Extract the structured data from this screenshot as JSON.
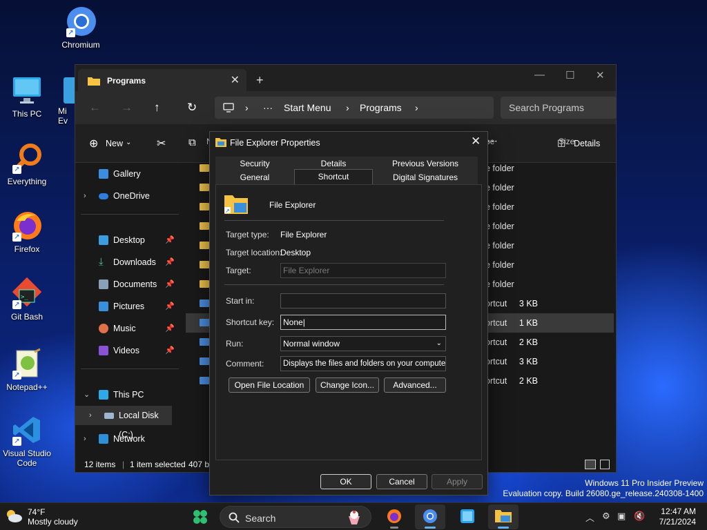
{
  "desktop": {
    "icons": [
      {
        "label": "Chromium"
      },
      {
        "label": "This PC"
      },
      {
        "label": "Everything"
      },
      {
        "label": "Firefox"
      },
      {
        "label": "Git Bash"
      },
      {
        "label": "Notepad++"
      },
      {
        "label": "Visual Studio Code"
      },
      {
        "label": "Mi Ev"
      }
    ]
  },
  "explorer": {
    "tab_title": "Programs",
    "breadcrumb": [
      "Start Menu",
      "Programs"
    ],
    "search_placeholder": "Search Programs",
    "cmd": {
      "new_label": "New",
      "details_label": "Details"
    },
    "sidebar": {
      "gallery": "Gallery",
      "onedrive": "OneDrive",
      "quick": [
        {
          "label": "Desktop"
        },
        {
          "label": "Downloads"
        },
        {
          "label": "Documents"
        },
        {
          "label": "Pictures"
        },
        {
          "label": "Music"
        },
        {
          "label": "Videos"
        }
      ],
      "this_pc": "This PC",
      "local_disk": "Local Disk (C:)",
      "network": "Network"
    },
    "columns": {
      "name_partial": "N",
      "type_partial": "pe",
      "size": "Size"
    },
    "rows": [
      {
        "type": "e folder",
        "size": ""
      },
      {
        "type": "e folder",
        "size": ""
      },
      {
        "type": "e folder",
        "size": ""
      },
      {
        "type": "e folder",
        "size": ""
      },
      {
        "type": "e folder",
        "size": ""
      },
      {
        "type": "e folder",
        "size": ""
      },
      {
        "type": "e folder",
        "size": ""
      },
      {
        "type": "ortcut",
        "size": "3 KB"
      },
      {
        "type": "ortcut",
        "size": "1 KB"
      },
      {
        "type": "ortcut",
        "size": "2 KB"
      },
      {
        "type": "ortcut",
        "size": "3 KB"
      },
      {
        "type": "ortcut",
        "size": "2 KB"
      }
    ],
    "status": {
      "items": "12 items",
      "selected": "1 item selected",
      "size": "407 by"
    }
  },
  "dialog": {
    "title": "File Explorer Properties",
    "tabs_row1": [
      "Security",
      "Details",
      "Previous Versions"
    ],
    "tabs_row2": [
      "General",
      "Shortcut",
      "Digital Signatures"
    ],
    "active_tab": "Shortcut",
    "app_name": "File Explorer",
    "target_type_label": "Target type:",
    "target_type_value": "File Explorer",
    "target_location_label": "Target location:",
    "target_location_value": "Desktop",
    "target_label": "Target:",
    "target_value": "File Explorer",
    "start_in_label": "Start in:",
    "start_in_value": "",
    "shortcut_key_label": "Shortcut key:",
    "shortcut_key_value": "None",
    "run_label": "Run:",
    "run_value": "Normal window",
    "comment_label": "Comment:",
    "comment_value": "Displays the files and folders on your computer.",
    "buttons": {
      "open_location": "Open File Location",
      "change_icon": "Change Icon...",
      "advanced": "Advanced...",
      "ok": "OK",
      "cancel": "Cancel",
      "apply": "Apply"
    }
  },
  "watermark": {
    "line1": "Windows 11 Pro Insider Preview",
    "line2": "Evaluation copy. Build 26080.ge_release.240308-1400"
  },
  "taskbar": {
    "weather_temp": "74°F",
    "weather_desc": "Mostly cloudy",
    "search_label": "Search",
    "time": "12:47 AM",
    "date": "7/21/2024"
  }
}
